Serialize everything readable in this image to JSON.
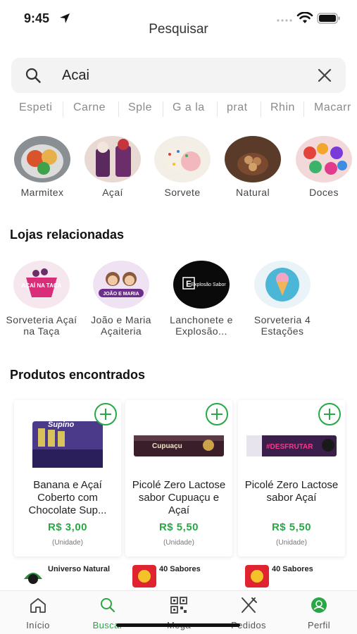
{
  "status_bar": {
    "time": "9:45"
  },
  "header": {
    "title": "Pesquisar"
  },
  "search": {
    "value": "Acai"
  },
  "suggestions": [
    "Espeti",
    "Carne",
    "Sple",
    "G a la",
    "prat",
    "Rhin",
    "Macarr"
  ],
  "categories": [
    {
      "label": "Marmitex"
    },
    {
      "label": "Açaí"
    },
    {
      "label": "Sorvete"
    },
    {
      "label": "Natural"
    },
    {
      "label": "Doces"
    }
  ],
  "stores_section": {
    "title": "Lojas relacionadas"
  },
  "stores": [
    {
      "name": "Sorveteria Açaí na Taça",
      "logo_text": "AÇAÍ NA TAÇA"
    },
    {
      "name": "João e Maria Açaiteria",
      "logo_text": "JOÃO E MARIA"
    },
    {
      "name": "Lanchonete e Explosão...",
      "logo_text": "Explosão Sabor",
      "logo_letter": "E"
    },
    {
      "name": "Sorveteria 4 Estações",
      "logo_text": ""
    }
  ],
  "products_section": {
    "title": "Produtos encontrados"
  },
  "products": [
    {
      "name": "Banana e Açaí Coberto com Chocolate Sup...",
      "price": "R$ 3,00",
      "unit": "(Unidade)",
      "image_text": "Supino",
      "vendor": "Universo Natural"
    },
    {
      "name": "Picolé Zero Lactose sabor Cupuaçu e Açaí",
      "price": "R$ 5,50",
      "unit": "(Unidade)",
      "image_text": "Cupuaçu",
      "vendor": "40 Sabores"
    },
    {
      "name": "Picolé Zero Lactose sabor Açaí",
      "price": "R$ 5,50",
      "unit": "(Unidade)",
      "image_text": "#DESFRUTAR",
      "vendor": "40 Sabores"
    }
  ],
  "tabs": [
    {
      "label": "Início",
      "icon": "home-icon"
    },
    {
      "label": "Buscar",
      "icon": "search-icon",
      "active": true
    },
    {
      "label": "Mega",
      "icon": "qr-code-icon"
    },
    {
      "label": "Pedidos",
      "icon": "cutlery-icon"
    },
    {
      "label": "Perfil",
      "icon": "profile-icon"
    }
  ],
  "colors": {
    "accent": "#27a845",
    "chip_text": "#8a8a8a",
    "search_bg": "#f3f3f3"
  }
}
